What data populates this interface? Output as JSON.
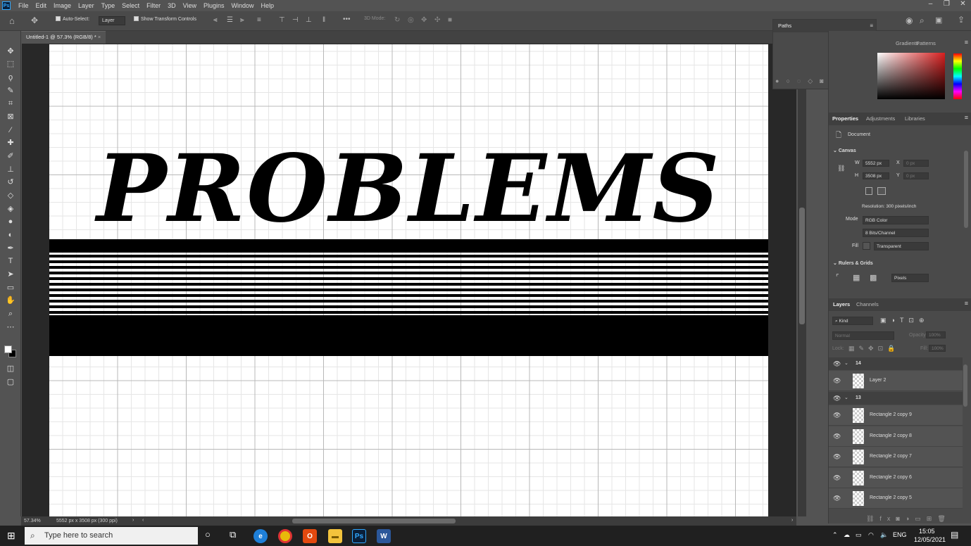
{
  "menu": {
    "items": [
      "File",
      "Edit",
      "Image",
      "Layer",
      "Type",
      "Select",
      "Filter",
      "3D",
      "View",
      "Plugins",
      "Window",
      "Help"
    ]
  },
  "options": {
    "auto_select": "Auto-Select:",
    "layer_select": "Layer",
    "show_transform": "Show Transform Controls",
    "mode_3d": "3D Mode:"
  },
  "document": {
    "tab_title": "Untitled-1 @ 57.3% (RGB/8) *",
    "canvas_text": "PROBLEMS"
  },
  "status": {
    "zoom": "57.34%",
    "doc_info": "5552 px x 3508 px (300 ppi)"
  },
  "paths_panel": {
    "title": "Paths"
  },
  "color_panel": {
    "tabs": [
      "Gradients",
      "Patterns"
    ],
    "hue_colors": [
      "#ff0000",
      "#ffff00",
      "#00ff00",
      "#00ffff",
      "#0000ff",
      "#ff00ff",
      "#ff0000"
    ],
    "picked_color": "#b02020"
  },
  "properties": {
    "tabs": [
      "Properties",
      "Adjustments",
      "Libraries"
    ],
    "doc_label": "Document",
    "canvas_header": "Canvas",
    "w_label": "W",
    "w_value": "5552 px",
    "h_label": "H",
    "h_value": "3508 px",
    "x_label": "X",
    "x_placeholder": "0 px",
    "y_label": "Y",
    "y_placeholder": "0 px",
    "resolution": "Resolution: 300 pixels/inch",
    "mode_label": "Mode",
    "mode_value": "RGB Color",
    "bits_value": "8 Bits/Channel",
    "fill_label": "Fill",
    "fill_value": "Transparent",
    "rulers_header": "Rulers & Grids",
    "units_value": "Pixels"
  },
  "layers": {
    "tabs": [
      "Layers",
      "Channels"
    ],
    "kind": "Kind",
    "blend": "Normal",
    "opacity_label": "Opacity:",
    "opacity_value": "100%",
    "lock_label": "Lock:",
    "fill_label": "Fill:",
    "fill_value": "100%",
    "groups": [
      {
        "name": "14",
        "children": [
          "Layer 2"
        ]
      },
      {
        "name": "13",
        "children": [
          "Rectangle 2 copy 9",
          "Rectangle 2 copy 8",
          "Rectangle 2 copy 7",
          "Rectangle 2 copy 6",
          "Rectangle 2 copy 5"
        ]
      }
    ]
  },
  "taskbar": {
    "search_placeholder": "Type here to search",
    "time": "15:05",
    "date": "12/05/2021",
    "lang": "ENG"
  }
}
